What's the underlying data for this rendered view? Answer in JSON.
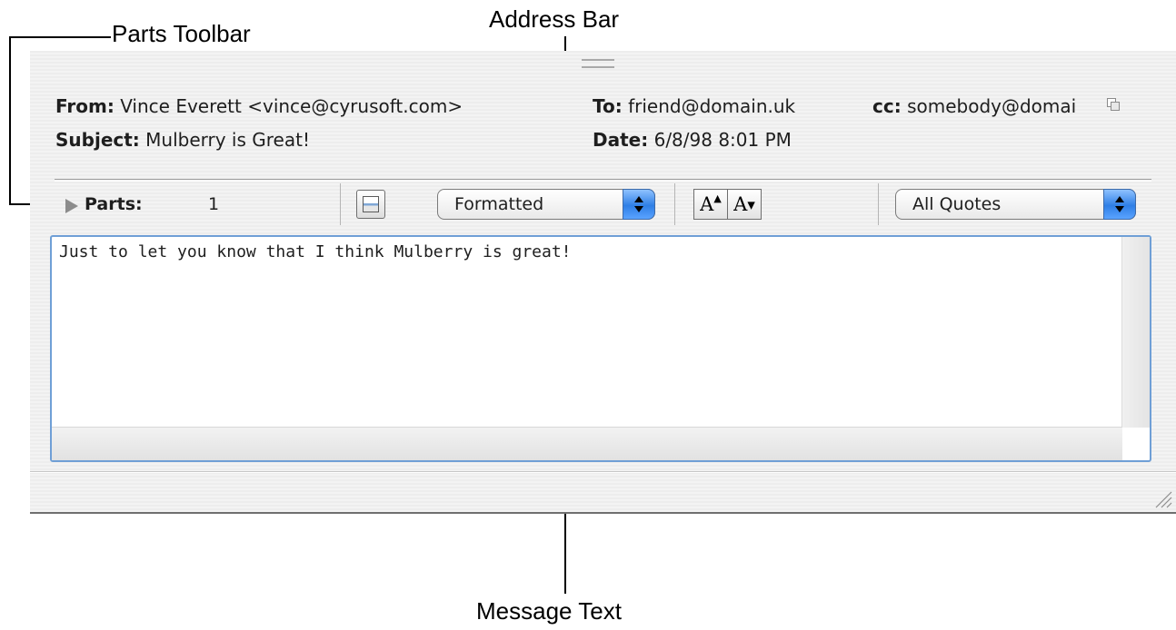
{
  "callouts": {
    "parts_toolbar": "Parts Toolbar",
    "address_bar": "Address Bar",
    "message_text": "Message Text"
  },
  "header": {
    "from_label": "From:",
    "from_value": "Vince Everett <vince@cyrusoft.com>",
    "to_label": "To:",
    "to_value": "friend@domain.uk",
    "cc_label": "cc:",
    "cc_value": "somebody@domai",
    "subject_label": "Subject:",
    "subject_value": "Mulberry is Great!",
    "date_label": "Date:",
    "date_value": "6/8/98 8:01 PM"
  },
  "parts_toolbar": {
    "parts_label": "Parts:",
    "parts_count": "1",
    "view_popup": "Formatted",
    "font_increase": "A",
    "font_decrease": "A",
    "quotes_popup": "All Quotes"
  },
  "message": {
    "body": "Just to let you know that I think Mulberry is great!"
  },
  "colors": {
    "popup_accent": "#2f7fe6",
    "text_focus_border": "#6f9fd6"
  },
  "icons": [
    "address-expand-icon",
    "disclosure-triangle-icon",
    "window-icon",
    "popup-arrows-icon",
    "resize-grip-icon"
  ]
}
